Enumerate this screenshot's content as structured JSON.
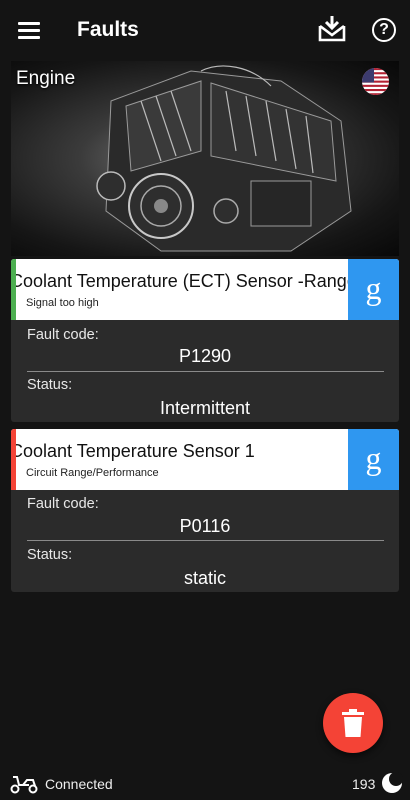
{
  "header": {
    "title": "Faults"
  },
  "hero": {
    "title": "Engine"
  },
  "faults": [
    {
      "name": "Coolant Temperature (ECT) Sensor -Range",
      "description": "Signal too high",
      "fault_code_label": "Fault code:",
      "fault_code": "P1290",
      "status_label": "Status:",
      "status": "Intermittent",
      "indicator_color": "#4caf50"
    },
    {
      "name": "Coolant Temperature Sensor 1",
      "description": "Circuit Range/Performance",
      "fault_code_label": "Fault code:",
      "fault_code": "P0116",
      "status_label": "Status:",
      "status": "static",
      "indicator_color": "#f44336"
    }
  ],
  "google_label": "g",
  "statusbar": {
    "connection": "Connected",
    "count": "193"
  },
  "colors": {
    "background": "#141414",
    "card": "#2b2b2b",
    "google_blue": "#2f97f0",
    "fab_red": "#f44336"
  },
  "icons": [
    "menu-icon",
    "download-icon",
    "help-icon",
    "us-flag-icon",
    "google-icon",
    "trash-icon",
    "scooter-icon",
    "moon-icon"
  ]
}
